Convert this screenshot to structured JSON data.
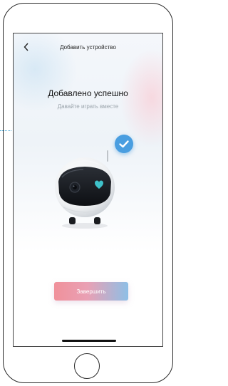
{
  "header": {
    "back_icon": "chevron-left-icon",
    "title": "Добавить устройство"
  },
  "main": {
    "headline": "Добавлено успешно",
    "subtitle": "Давайте играть вместе",
    "success_icon": "checkmark-icon",
    "device_image": "robot-camera"
  },
  "footer": {
    "finish_label": "Завершить"
  },
  "colors": {
    "check_badge": "#4a9ee0",
    "button_start": "#f0919b",
    "button_end": "#8ebfe6",
    "subtitle_text": "#9aa3ab",
    "heart_accent": "#3ec1c9"
  }
}
